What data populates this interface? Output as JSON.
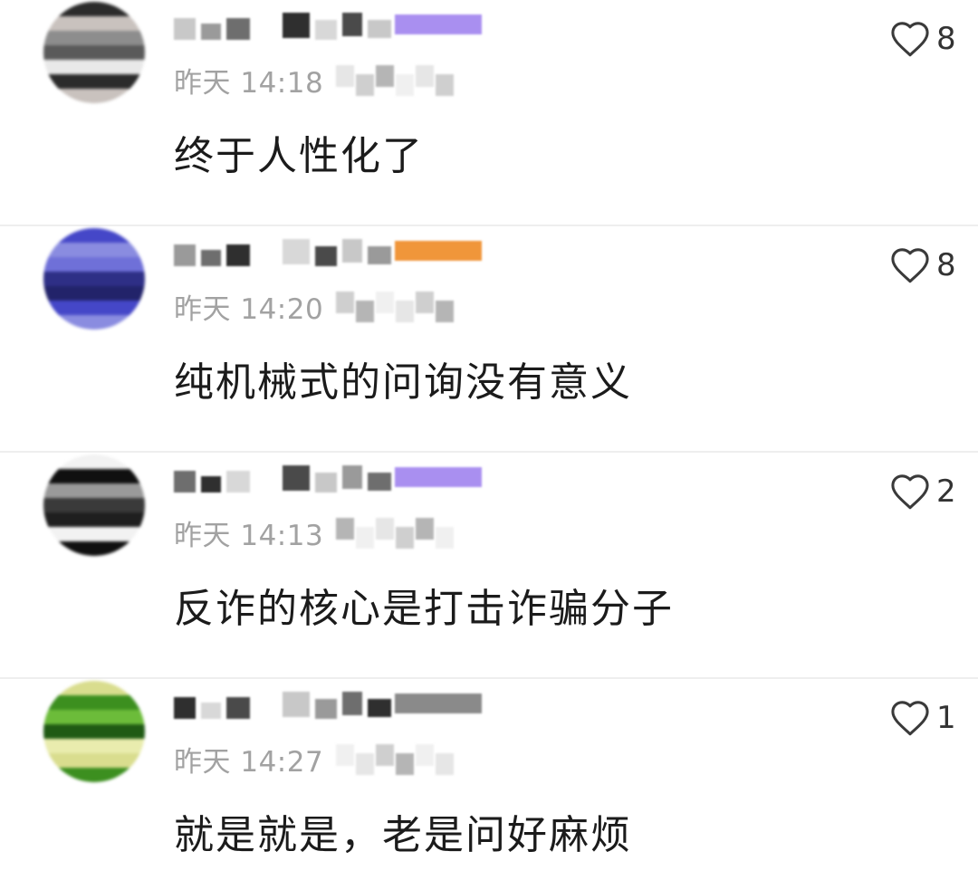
{
  "comments": [
    {
      "time": "昨天 14:18",
      "text": "终于人性化了",
      "likes": "8",
      "avatar_colors": [
        "#2b2b2b",
        "#8d8d8d",
        "#e9e9e9",
        "#c9c2be",
        "#5a5a5a"
      ],
      "badge_color": "#a98ff0"
    },
    {
      "time": "昨天 14:20",
      "text": "纯机械式的问询没有意义",
      "likes": "8",
      "avatar_colors": [
        "#2e2f86",
        "#4547c8",
        "#6f70d8",
        "#22236a",
        "#8a8ce0"
      ],
      "badge_color": "#f0963a"
    },
    {
      "time": "昨天 14:13",
      "text": "反诈的核心是打击诈骗分子",
      "likes": "2",
      "avatar_colors": [
        "#101010",
        "#3a3a3a",
        "#f2f2f2",
        "#9a9a9a",
        "#1f1f1f"
      ],
      "badge_color": "#a98ff0"
    },
    {
      "time": "昨天 14:27",
      "text": "就是就是，老是问好麻烦",
      "likes": "1",
      "avatar_colors": [
        "#e9ecae",
        "#3c8f1f",
        "#1f5a14",
        "#d9dd8e",
        "#6cbc3a"
      ],
      "badge_color": "#8a8a8a"
    }
  ]
}
